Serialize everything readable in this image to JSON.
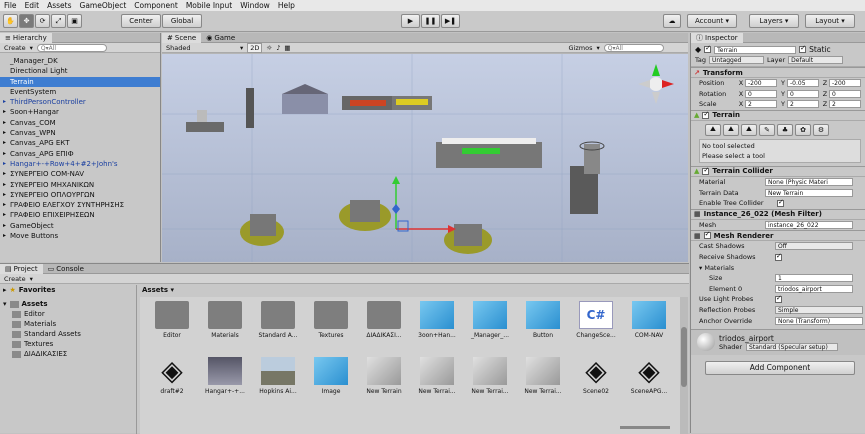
{
  "menu": [
    "File",
    "Edit",
    "Assets",
    "GameObject",
    "Component",
    "Mobile Input",
    "Window",
    "Help"
  ],
  "toolbar": {
    "center": "Center",
    "global": "Global",
    "account": "Account",
    "layers": "Layers",
    "layout": "Layout"
  },
  "hierarchy": {
    "tab": "Hierarchy",
    "create": "Create",
    "search": "Q▾All",
    "items": [
      {
        "label": "_Manager_DK",
        "style": ""
      },
      {
        "label": "Directional Light",
        "style": ""
      },
      {
        "label": "Terrain",
        "style": "sel"
      },
      {
        "label": "EventSystem",
        "style": ""
      },
      {
        "label": "ThirdPersonController",
        "style": "blue exp"
      },
      {
        "label": "Soon+Hangar",
        "style": "exp"
      },
      {
        "label": "Canvas_COM",
        "style": "exp"
      },
      {
        "label": "Canvas_WPN",
        "style": "exp"
      },
      {
        "label": "Canvas_APG ЕКТ",
        "style": "exp"
      },
      {
        "label": "Canvas_APG ЕПІФ",
        "style": "exp"
      },
      {
        "label": "Hangar+-+Row+4+#2+John's",
        "style": "blue exp"
      },
      {
        "label": "ΣΥΝΕΡΓΕΙΟ COM-NAV",
        "style": "exp"
      },
      {
        "label": "ΣΥΝΕΡΓΕΙΟ ΜΗΧΑΝΙΚΩΝ",
        "style": "exp"
      },
      {
        "label": "ΣΥΝΕΡΓΕΙΟ ΟΠΛΟΥΡΓΩΝ",
        "style": "exp"
      },
      {
        "label": "ΓΡΑΦΕΙΟ ΕΛΕΓΧΟΥ ΣΥΝΤΗΡΗΣΗΣ",
        "style": "exp"
      },
      {
        "label": "ΓΡΑΦΕΙΟ ΕΠΙΧΕΙΡΗΣΕΩΝ",
        "style": "exp"
      },
      {
        "label": "GameObject",
        "style": "exp"
      },
      {
        "label": "Move Buttons",
        "style": "exp"
      }
    ]
  },
  "scene": {
    "tab_scene": "Scene",
    "tab_game": "Game",
    "shaded": "Shaded",
    "mode2d": "2D",
    "gizmos": "Gizmos",
    "search": "Q▾All"
  },
  "inspector": {
    "tab": "Inspector",
    "name": "Terrain",
    "static": "Static",
    "tag_label": "Tag",
    "tag": "Untagged",
    "layer_label": "Layer",
    "layer": "Default",
    "transform": {
      "title": "Transform",
      "position": "Position",
      "rotation": "Rotation",
      "scale": "Scale",
      "pos": [
        "-200",
        "-0.05",
        "-200"
      ],
      "rot": [
        "0",
        "0",
        "0"
      ],
      "scl": [
        "2",
        "2",
        "2"
      ]
    },
    "terrain": {
      "title": "Terrain",
      "msg1": "No tool selected",
      "msg2": "Please select a tool"
    },
    "collider": {
      "title": "Terrain Collider",
      "material_label": "Material",
      "material": "None (Physic Materi",
      "data_label": "Terrain Data",
      "data": "New Terrain",
      "trees": "Enable Tree Collider"
    },
    "mesh_filter": {
      "title": "Instance_26_022 (Mesh Filter)",
      "mesh_label": "Mesh",
      "mesh": "instance_26_022"
    },
    "renderer": {
      "title": "Mesh Renderer",
      "cast": "Cast Shadows",
      "cast_val": "Off",
      "receive": "Receive Shadows",
      "materials": "Materials",
      "size": "Size",
      "size_val": "1",
      "elem": "Element 0",
      "elem_val": "triodos_airport",
      "probes": "Use Light Probes",
      "refl": "Reflection Probes",
      "refl_val": "Simple",
      "anchor": "Anchor Override",
      "anchor_val": "None (Transform)"
    },
    "material": {
      "name": "triodos_airport",
      "shader_label": "Shader",
      "shader": "Standard (Specular setup)"
    },
    "add_component": "Add Component"
  },
  "project": {
    "tab": "Project",
    "console": "Console",
    "create": "Create",
    "favorites": "Favorites",
    "assets": "Assets",
    "tree": [
      "Editor",
      "Materials",
      "Standard Assets",
      "Textures",
      "ΔΙΑΔΙΚΑΣΙΕΣ"
    ],
    "breadcrumb": "Assets",
    "row1": [
      {
        "n": "Editor",
        "t": "folder"
      },
      {
        "n": "Materials",
        "t": "folder"
      },
      {
        "n": "Standard A...",
        "t": "folder"
      },
      {
        "n": "Textures",
        "t": "folder"
      },
      {
        "n": "ΔΙΑΔΙΚΑΣΙ...",
        "t": "folder"
      },
      {
        "n": "3oon+Han...",
        "t": "cube"
      },
      {
        "n": "_Manager_...",
        "t": "cube"
      },
      {
        "n": "Button",
        "t": "cube"
      },
      {
        "n": "ChangeSce...",
        "t": "cs"
      },
      {
        "n": "COM-NAV",
        "t": "cube"
      }
    ],
    "row2": [
      {
        "n": "draft#2",
        "t": "unity"
      },
      {
        "n": "Hangar+-+...",
        "t": "img"
      },
      {
        "n": "Hopkins Ai...",
        "t": "img2"
      },
      {
        "n": "Image",
        "t": "cube"
      },
      {
        "n": "New Terrain",
        "t": "gray"
      },
      {
        "n": "New Terrai...",
        "t": "gray"
      },
      {
        "n": "New Terrai...",
        "t": "gray"
      },
      {
        "n": "New Terrai...",
        "t": "gray"
      },
      {
        "n": "Scene02",
        "t": "unity"
      },
      {
        "n": "SceneAPG...",
        "t": "unity"
      }
    ]
  }
}
